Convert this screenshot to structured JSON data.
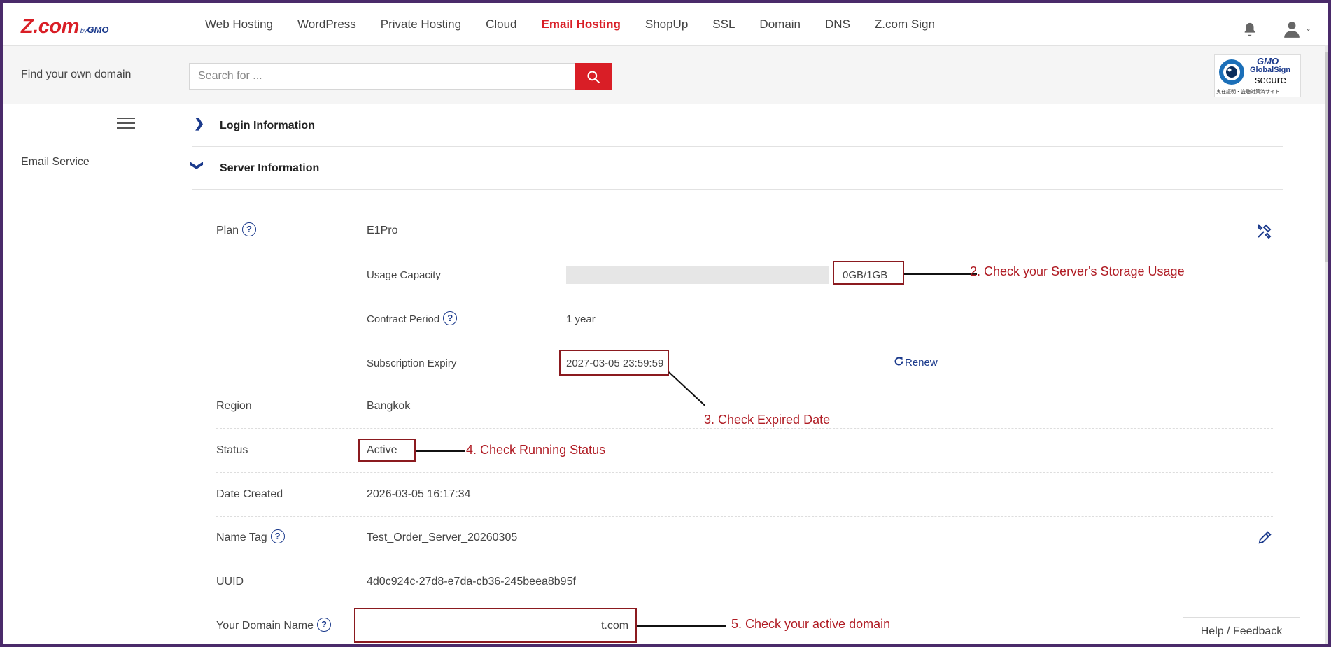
{
  "nav": {
    "logo": {
      "main": "Z.com",
      "by": "by",
      "brand": "GMO"
    },
    "items": [
      {
        "label": "Web Hosting",
        "active": false
      },
      {
        "label": "WordPress",
        "active": false
      },
      {
        "label": "Private Hosting",
        "active": false
      },
      {
        "label": "Cloud",
        "active": false
      },
      {
        "label": "Email Hosting",
        "active": true
      },
      {
        "label": "ShopUp",
        "active": false
      },
      {
        "label": "SSL",
        "active": false
      },
      {
        "label": "Domain",
        "active": false
      },
      {
        "label": "DNS",
        "active": false
      },
      {
        "label": "Z.com Sign",
        "active": false
      }
    ],
    "bell_icon": "bell-icon",
    "user_icon": "user-icon"
  },
  "search": {
    "label": "Find your own domain",
    "placeholder": "Search for ...",
    "value": "",
    "button_icon": "search-icon"
  },
  "badge": {
    "line1": "GMO",
    "line2": "GlobalSign",
    "line3": "secure",
    "line4": "実在証明・盗聴対策済サイト"
  },
  "sidebar": {
    "items": [
      {
        "label": "Email Service"
      }
    ]
  },
  "sections": {
    "login": {
      "title": "Login Information",
      "expanded": false
    },
    "server": {
      "title": "Server Information",
      "expanded": true
    }
  },
  "server": {
    "plan": {
      "label": "Plan",
      "value": "E1Pro"
    },
    "usage": {
      "label": "Usage Capacity",
      "value": "0GB/1GB",
      "fraction": 0
    },
    "contract": {
      "label": "Contract Period",
      "value": "1 year"
    },
    "expiry": {
      "label": "Subscription Expiry",
      "value": "2027-03-05 23:59:59",
      "renew": "Renew"
    },
    "region": {
      "label": "Region",
      "value": "Bangkok"
    },
    "status": {
      "label": "Status",
      "value": "Active"
    },
    "created": {
      "label": "Date Created",
      "value": "2026-03-05 16:17:34"
    },
    "nametag": {
      "label": "Name Tag",
      "value": "Test_Order_Server_20260305"
    },
    "uuid": {
      "label": "UUID",
      "value": "4d0c924c-27d8-e7da-cb36-245beea8b95f"
    },
    "domain": {
      "label": "Your Domain Name",
      "value": "t.com"
    }
  },
  "annotations": {
    "a2": "2. Check your Server's Storage Usage",
    "a3": "3. Check Expired Date",
    "a4": "4. Check Running Status",
    "a5": "5. Check your active domain"
  },
  "help_feedback": "Help / Feedback",
  "colors": {
    "brand_red": "#d91e26",
    "brand_blue": "#1b3a8c",
    "annotation_red": "#b01c24"
  }
}
